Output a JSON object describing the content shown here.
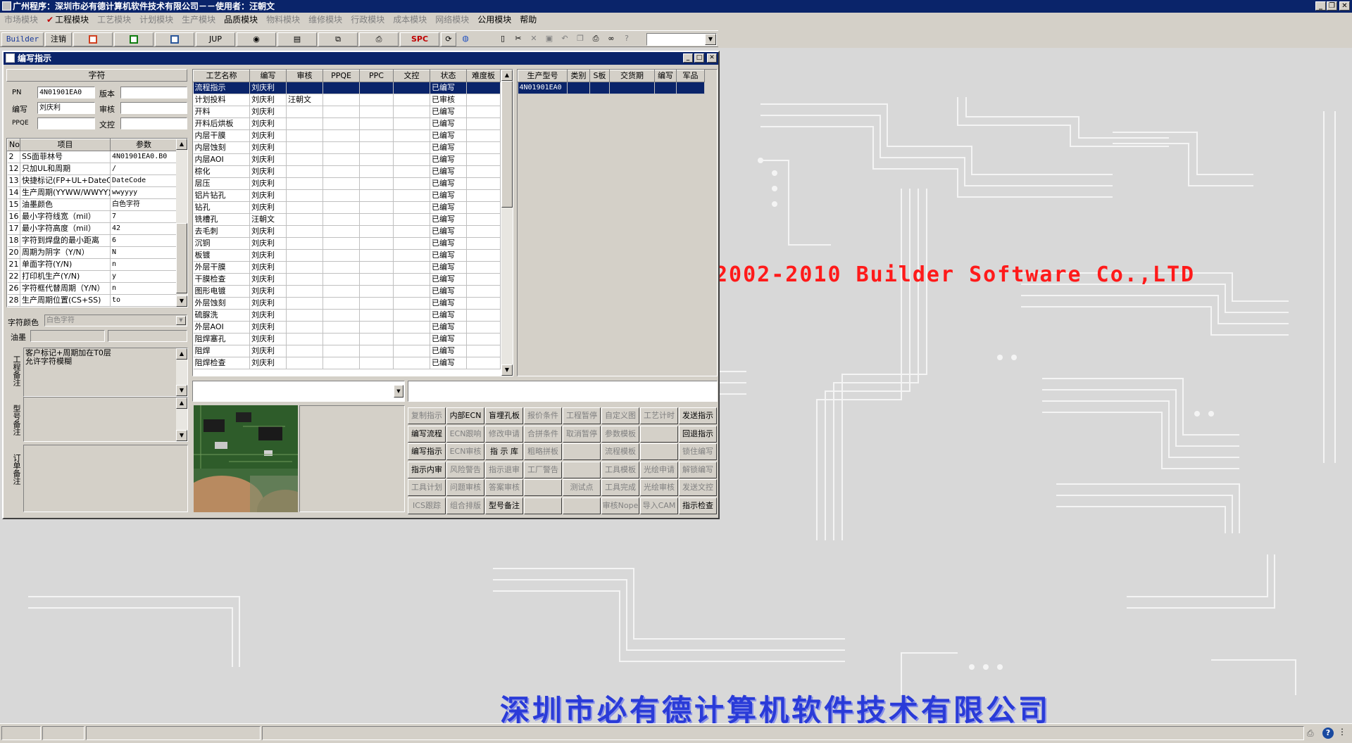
{
  "app": {
    "title": "广州程序：深圳市必有德计算机软件技术有限公司－－使用者：汪朝文",
    "window_buttons": [
      "_",
      "❐",
      "✕"
    ]
  },
  "menu": {
    "items": [
      "市场模块",
      "工程模块",
      "工艺模块",
      "计划模块",
      "生产模块",
      "品质模块",
      "物料模块",
      "维修模块",
      "行政模块",
      "成本模块",
      "网络模块",
      "公用模块",
      "帮助"
    ],
    "enabled": [
      false,
      true,
      false,
      false,
      false,
      true,
      false,
      false,
      false,
      false,
      false,
      true,
      true
    ],
    "checked_index": 1
  },
  "toolbar": {
    "builder": "Builder",
    "logout": "注销",
    "jup": "JUP",
    "spc": "SPC",
    "accent_red": "#c00000",
    "accent_green": "#107c10",
    "accent_blue": "#2b579a"
  },
  "background": {
    "copyright": "2002-2010 Builder Software Co.,LTD",
    "company": "深圳市必有德计算机软件技术有限公司",
    "copyright_color": "#ff1a1a",
    "company_color": "#2a3bd8"
  },
  "window": {
    "title": "编写指示",
    "left": {
      "section_title": "字符",
      "pn_label": "PN",
      "pn_value": "4N01901EA0",
      "version_label": "版本",
      "version_value": "",
      "author_label": "编写",
      "author_value": "刘庆利",
      "review_label": "审核",
      "review_value": "",
      "ppqe_label": "PPQE",
      "ppqe_value": "",
      "doccontrol_label": "文控",
      "doccontrol_value": "",
      "param_headers": [
        "No",
        "项目",
        "参数"
      ],
      "params": [
        {
          "no": "2",
          "item": "SS面菲林号",
          "value": "4N01901EA0.B0"
        },
        {
          "no": "12",
          "item": "只加UL和周期",
          "value": "/"
        },
        {
          "no": "13",
          "item": "快捷标记(FP+UL+DateCo",
          "value": "DateCode"
        },
        {
          "no": "14",
          "item": "生产周期(YYWW/WWYY)",
          "value": "wwyyyy"
        },
        {
          "no": "15",
          "item": "油墨颜色",
          "value": "白色字符"
        },
        {
          "no": "16",
          "item": "最小字符线宽（mil）",
          "value": "7"
        },
        {
          "no": "17",
          "item": "最小字符高度（mil）",
          "value": "42"
        },
        {
          "no": "18",
          "item": "字符到焊盘的最小距离",
          "value": "6"
        },
        {
          "no": "20",
          "item": "周期为阴字（Y/N）",
          "value": "N"
        },
        {
          "no": "21",
          "item": "单面字符(Y/N)",
          "value": "n"
        },
        {
          "no": "22",
          "item": "打印机生产(Y/N)",
          "value": "y"
        },
        {
          "no": "26",
          "item": "字符框代替周期（Y/N）",
          "value": "n"
        },
        {
          "no": "28",
          "item": "生产周期位置(CS+SS)",
          "value": "to"
        }
      ],
      "char_color_label": "字符颜色",
      "char_color_value": "白色字符",
      "ink_label": "油墨",
      "ink_value_1": "",
      "ink_value_2": "",
      "eng_note_label": "工程备注",
      "eng_note_text": "客户标记+周期加在T0层\n允许字符模糊",
      "model_note_label": "型号备注",
      "model_note_text": "",
      "order_note_label": "订单备注",
      "order_note_text": ""
    },
    "process": {
      "headers": [
        "工艺名称",
        "编写",
        "审核",
        "PPQE",
        "PPC",
        "文控",
        "状态",
        "难度板"
      ],
      "rows": [
        [
          "流程指示",
          "刘庆利",
          "",
          "",
          "",
          "",
          "已编写",
          ""
        ],
        [
          "计划投料",
          "刘庆利",
          "汪朝文",
          "",
          "",
          "",
          "已审核",
          ""
        ],
        [
          "开料",
          "刘庆利",
          "",
          "",
          "",
          "",
          "已编写",
          ""
        ],
        [
          "开料后烘板",
          "刘庆利",
          "",
          "",
          "",
          "",
          "已编写",
          ""
        ],
        [
          "内层干膜",
          "刘庆利",
          "",
          "",
          "",
          "",
          "已编写",
          ""
        ],
        [
          "内层蚀刻",
          "刘庆利",
          "",
          "",
          "",
          "",
          "已编写",
          ""
        ],
        [
          "内层AOI",
          "刘庆利",
          "",
          "",
          "",
          "",
          "已编写",
          ""
        ],
        [
          "棕化",
          "刘庆利",
          "",
          "",
          "",
          "",
          "已编写",
          ""
        ],
        [
          "层压",
          "刘庆利",
          "",
          "",
          "",
          "",
          "已编写",
          ""
        ],
        [
          "铝片钻孔",
          "刘庆利",
          "",
          "",
          "",
          "",
          "已编写",
          ""
        ],
        [
          "钻孔",
          "刘庆利",
          "",
          "",
          "",
          "",
          "已编写",
          ""
        ],
        [
          "铣槽孔",
          "汪朝文",
          "",
          "",
          "",
          "",
          "已编写",
          ""
        ],
        [
          "去毛刺",
          "刘庆利",
          "",
          "",
          "",
          "",
          "已编写",
          ""
        ],
        [
          "沉铜",
          "刘庆利",
          "",
          "",
          "",
          "",
          "已编写",
          ""
        ],
        [
          "板镀",
          "刘庆利",
          "",
          "",
          "",
          "",
          "已编写",
          ""
        ],
        [
          "外层干膜",
          "刘庆利",
          "",
          "",
          "",
          "",
          "已编写",
          ""
        ],
        [
          "干膜检查",
          "刘庆利",
          "",
          "",
          "",
          "",
          "已编写",
          ""
        ],
        [
          "图形电镀",
          "刘庆利",
          "",
          "",
          "",
          "",
          "已编写",
          ""
        ],
        [
          "外层蚀刻",
          "刘庆利",
          "",
          "",
          "",
          "",
          "已编写",
          ""
        ],
        [
          "硫脲洗",
          "刘庆利",
          "",
          "",
          "",
          "",
          "已编写",
          ""
        ],
        [
          "外层AOI",
          "刘庆利",
          "",
          "",
          "",
          "",
          "已编写",
          ""
        ],
        [
          "阻焊塞孔",
          "刘庆利",
          "",
          "",
          "",
          "",
          "已编写",
          ""
        ],
        [
          "阻焊",
          "刘庆利",
          "",
          "",
          "",
          "",
          "已编写",
          ""
        ],
        [
          "阻焊检查",
          "刘庆利",
          "",
          "",
          "",
          "",
          "已编写",
          ""
        ]
      ],
      "selected_index": 0
    },
    "models": {
      "headers": [
        "生产型号",
        "类别",
        "S板",
        "交货期",
        "编写",
        "军品"
      ],
      "rows": [
        [
          "4N01901EA0",
          "",
          "",
          "",
          "",
          ""
        ]
      ]
    },
    "combo_value": "",
    "input_value": "",
    "buttons": [
      {
        "label": "复制指示",
        "enabled": false
      },
      {
        "label": "内部ECN",
        "enabled": true
      },
      {
        "label": "盲埋孔板",
        "enabled": true
      },
      {
        "label": "报价条件",
        "enabled": false
      },
      {
        "label": "工程暂停",
        "enabled": false
      },
      {
        "label": "自定义图",
        "enabled": false
      },
      {
        "label": "工艺计时",
        "enabled": false
      },
      {
        "label": "发送指示",
        "enabled": true
      },
      {
        "label": "编写流程",
        "enabled": true
      },
      {
        "label": "ECN跟响",
        "enabled": false
      },
      {
        "label": "修改申请",
        "enabled": false
      },
      {
        "label": "合拼条件",
        "enabled": false
      },
      {
        "label": "取消暂停",
        "enabled": false
      },
      {
        "label": "参数模板",
        "enabled": false
      },
      {
        "label": "",
        "enabled": false
      },
      {
        "label": "回退指示",
        "enabled": true
      },
      {
        "label": "编写指示",
        "enabled": true
      },
      {
        "label": "ECN审核",
        "enabled": false
      },
      {
        "label": "指 示 库",
        "enabled": true
      },
      {
        "label": "粗略拼板",
        "enabled": false
      },
      {
        "label": "",
        "enabled": false
      },
      {
        "label": "流程模板",
        "enabled": false
      },
      {
        "label": "",
        "enabled": false
      },
      {
        "label": "锁住编写",
        "enabled": false
      },
      {
        "label": "指示内审",
        "enabled": true
      },
      {
        "label": "风险警告",
        "enabled": false
      },
      {
        "label": "指示退审",
        "enabled": false
      },
      {
        "label": "工厂警告",
        "enabled": false
      },
      {
        "label": "",
        "enabled": false
      },
      {
        "label": "工具模板",
        "enabled": false
      },
      {
        "label": "光绘申请",
        "enabled": false
      },
      {
        "label": "解锁编写",
        "enabled": false
      },
      {
        "label": "工具计划",
        "enabled": false
      },
      {
        "label": "问题审核",
        "enabled": false
      },
      {
        "label": "答案审核",
        "enabled": false
      },
      {
        "label": "",
        "enabled": false
      },
      {
        "label": "测试点",
        "enabled": false
      },
      {
        "label": "工具完成",
        "enabled": false
      },
      {
        "label": "光绘审核",
        "enabled": false
      },
      {
        "label": "发送文控",
        "enabled": false
      },
      {
        "label": "ICS跟踪",
        "enabled": false
      },
      {
        "label": "组合排版",
        "enabled": false
      },
      {
        "label": "型号备注",
        "enabled": true
      },
      {
        "label": "",
        "enabled": false
      },
      {
        "label": "",
        "enabled": false
      },
      {
        "label": "审核Nope",
        "enabled": false
      },
      {
        "label": "导入CAM",
        "enabled": false
      },
      {
        "label": "指示检查",
        "enabled": true
      }
    ]
  }
}
